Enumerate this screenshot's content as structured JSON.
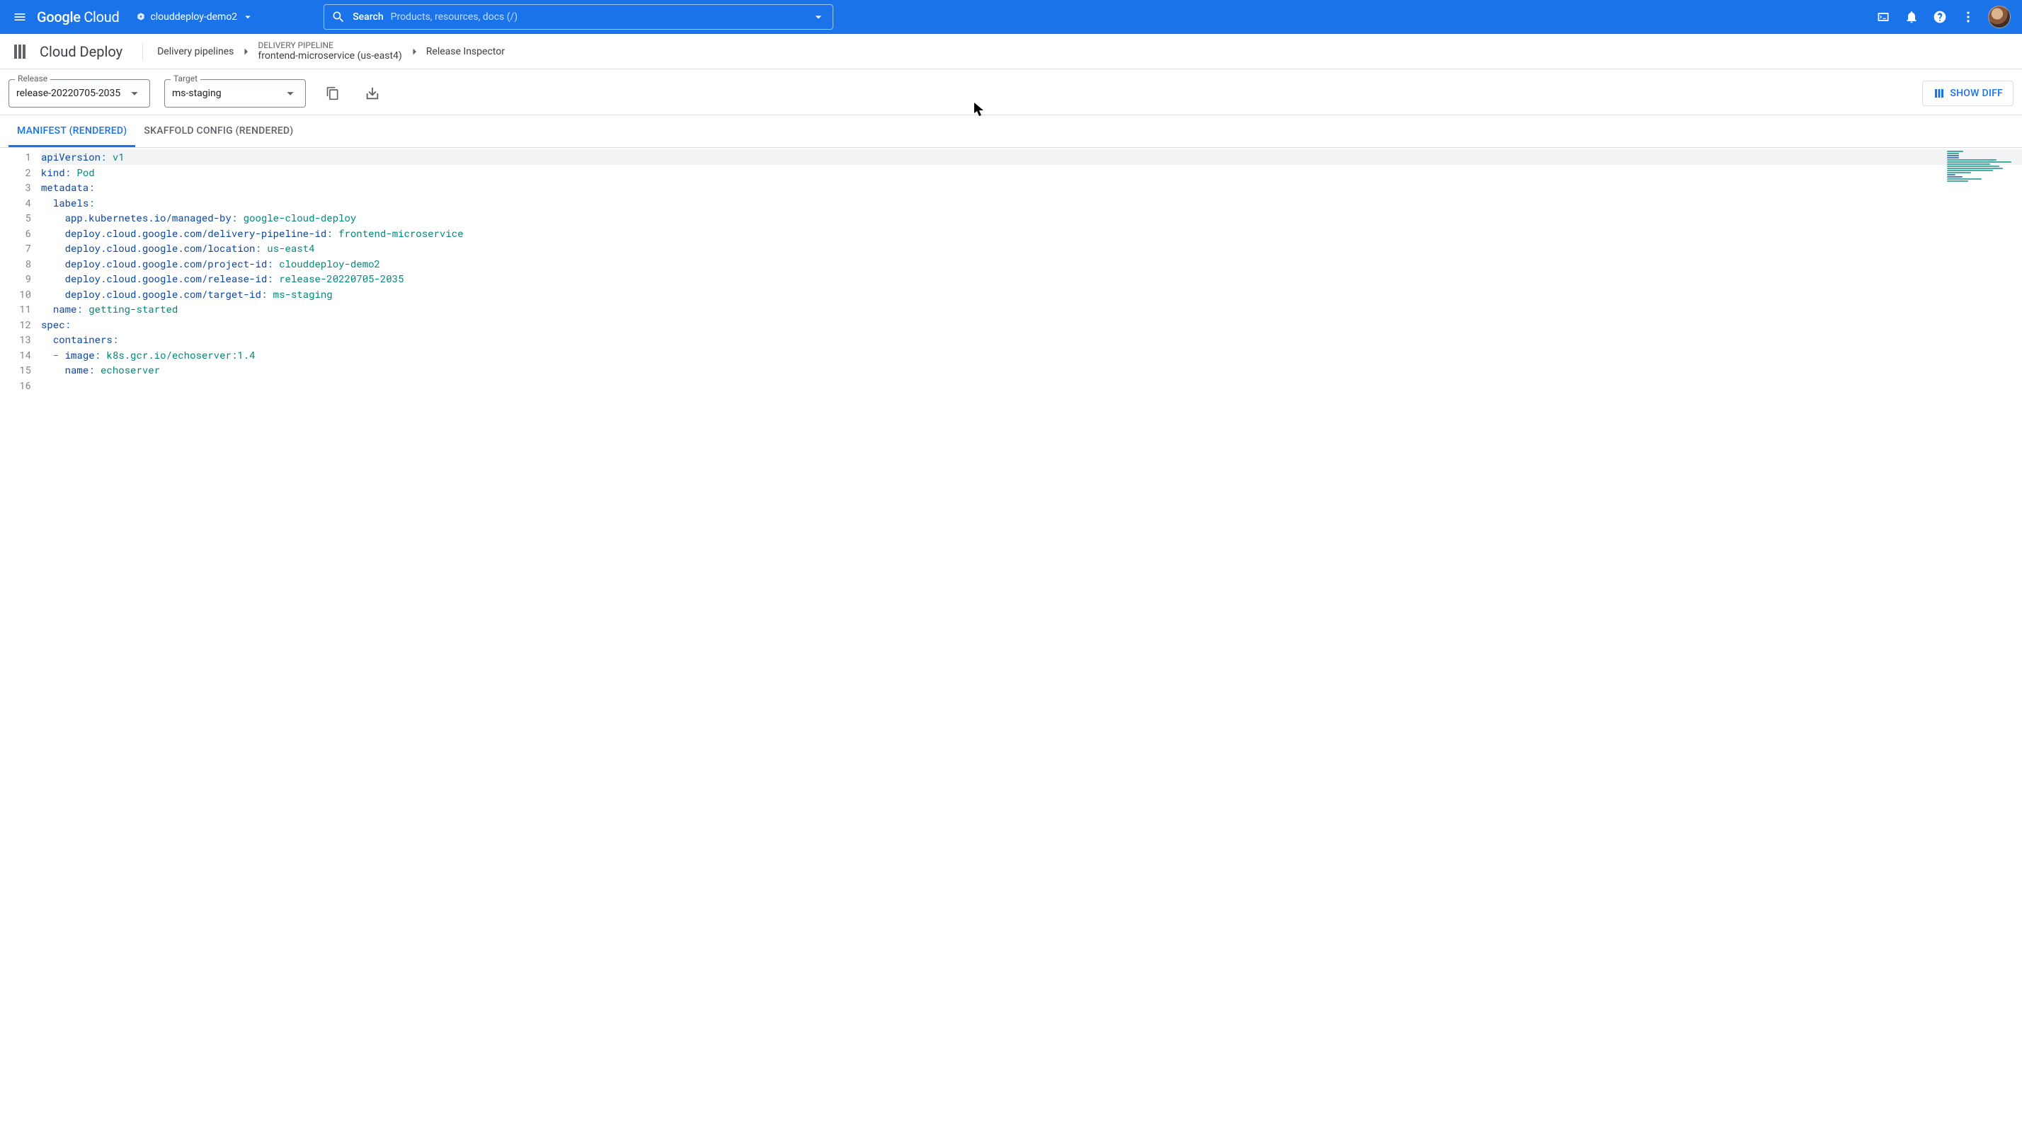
{
  "header": {
    "logo_a": "Google",
    "logo_b": "Cloud",
    "project": "clouddeploy-demo2",
    "search_label": "Search",
    "search_placeholder": "Products, resources, docs (/)"
  },
  "subheader": {
    "product_title": "Cloud Deploy",
    "breadcrumb": {
      "pipelines": "Delivery pipelines",
      "pipeline_sup": "DELIVERY PIPELINE",
      "pipeline_name": "frontend-microservice (us-east4)",
      "page": "Release Inspector"
    }
  },
  "toolbar": {
    "release_label": "Release",
    "release_value": "release-20220705-2035",
    "target_label": "Target",
    "target_value": "ms-staging",
    "show_diff": "SHOW DIFF"
  },
  "tabs": {
    "manifest": "MANIFEST (RENDERED)",
    "skaffold": "SKAFFOLD CONFIG (RENDERED)"
  },
  "code": {
    "lines": 16,
    "content": [
      {
        "n": 1,
        "hl": true,
        "segs": [
          [
            "key",
            "apiVersion"
          ],
          [
            "punc",
            ":"
          ],
          [
            "sp",
            " "
          ],
          [
            "val",
            "v1"
          ]
        ]
      },
      {
        "n": 2,
        "segs": [
          [
            "key",
            "kind"
          ],
          [
            "punc",
            ":"
          ],
          [
            "sp",
            " "
          ],
          [
            "val",
            "Pod"
          ]
        ]
      },
      {
        "n": 3,
        "segs": [
          [
            "key",
            "metadata"
          ],
          [
            "punc",
            ":"
          ]
        ]
      },
      {
        "n": 4,
        "segs": [
          [
            "indent",
            "  "
          ],
          [
            "key",
            "labels"
          ],
          [
            "punc",
            ":"
          ]
        ]
      },
      {
        "n": 5,
        "segs": [
          [
            "indent",
            "    "
          ],
          [
            "key",
            "app.kubernetes.io/managed-by"
          ],
          [
            "punc",
            ":"
          ],
          [
            "sp",
            " "
          ],
          [
            "val",
            "google-cloud-deploy"
          ]
        ]
      },
      {
        "n": 6,
        "segs": [
          [
            "indent",
            "    "
          ],
          [
            "key",
            "deploy.cloud.google.com/delivery-pipeline-id"
          ],
          [
            "punc",
            ":"
          ],
          [
            "sp",
            " "
          ],
          [
            "val",
            "frontend-microservice"
          ]
        ]
      },
      {
        "n": 7,
        "segs": [
          [
            "indent",
            "    "
          ],
          [
            "key",
            "deploy.cloud.google.com/location"
          ],
          [
            "punc",
            ":"
          ],
          [
            "sp",
            " "
          ],
          [
            "val",
            "us-east4"
          ]
        ]
      },
      {
        "n": 8,
        "segs": [
          [
            "indent",
            "    "
          ],
          [
            "key",
            "deploy.cloud.google.com/project-id"
          ],
          [
            "punc",
            ":"
          ],
          [
            "sp",
            " "
          ],
          [
            "val",
            "clouddeploy-demo2"
          ]
        ]
      },
      {
        "n": 9,
        "segs": [
          [
            "indent",
            "    "
          ],
          [
            "key",
            "deploy.cloud.google.com/release-id"
          ],
          [
            "punc",
            ":"
          ],
          [
            "sp",
            " "
          ],
          [
            "val",
            "release-20220705-2035"
          ]
        ]
      },
      {
        "n": 10,
        "segs": [
          [
            "indent",
            "    "
          ],
          [
            "key",
            "deploy.cloud.google.com/target-id"
          ],
          [
            "punc",
            ":"
          ],
          [
            "sp",
            " "
          ],
          [
            "val",
            "ms-staging"
          ]
        ]
      },
      {
        "n": 11,
        "segs": [
          [
            "indent",
            "  "
          ],
          [
            "key",
            "name"
          ],
          [
            "punc",
            ":"
          ],
          [
            "sp",
            " "
          ],
          [
            "val",
            "getting-started"
          ]
        ]
      },
      {
        "n": 12,
        "segs": [
          [
            "key",
            "spec"
          ],
          [
            "punc",
            ":"
          ]
        ]
      },
      {
        "n": 13,
        "segs": [
          [
            "indent",
            "  "
          ],
          [
            "key",
            "containers"
          ],
          [
            "punc",
            ":"
          ]
        ]
      },
      {
        "n": 14,
        "segs": [
          [
            "indent",
            "  "
          ],
          [
            "dash",
            "- "
          ],
          [
            "key",
            "image"
          ],
          [
            "punc",
            ":"
          ],
          [
            "sp",
            " "
          ],
          [
            "val",
            "k8s.gcr.io/echoserver:1.4"
          ]
        ]
      },
      {
        "n": 15,
        "segs": [
          [
            "indent",
            "    "
          ],
          [
            "key",
            "name"
          ],
          [
            "punc",
            ":"
          ],
          [
            "sp",
            " "
          ],
          [
            "val",
            "echoserver"
          ]
        ]
      },
      {
        "n": 16,
        "segs": []
      }
    ]
  }
}
